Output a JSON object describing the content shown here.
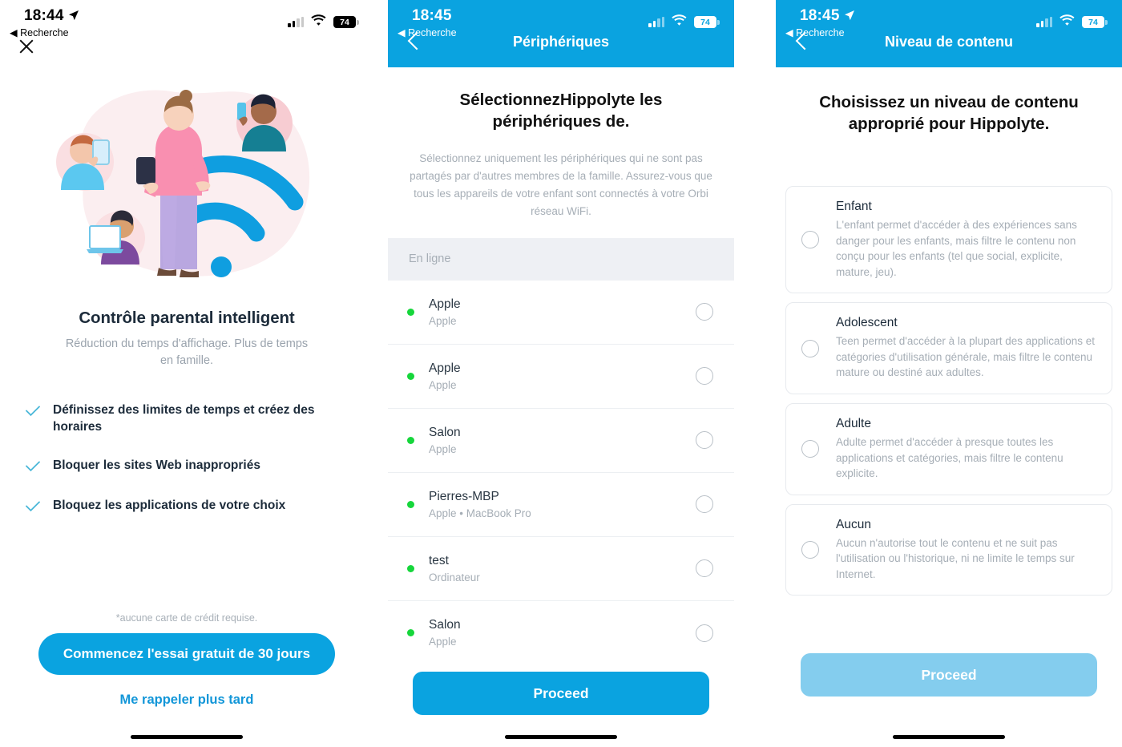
{
  "status_bar": {
    "time_left": "18:44",
    "time_mid": "18:45",
    "time_right": "18:45",
    "back_label": "◀ Recherche",
    "battery": "74",
    "location_arrow": "➤"
  },
  "colors": {
    "brand_blue": "#0aa3e0",
    "brand_blue_disabled": "#84cdee",
    "online_green": "#16d63b",
    "text_dark": "#1c2b3a",
    "text_muted": "#a6aeb6"
  },
  "onboarding": {
    "close_icon": "×",
    "title": "Contrôle parental intelligent",
    "subtitle": "Réduction du temps d'affichage. Plus de temps en famille.",
    "features": [
      "Définissez des limites de temps et créez des horaires",
      "Bloquer les sites Web inappropriés",
      "Bloquez les applications de votre choix"
    ],
    "note": "*aucune carte de crédit requise.",
    "cta_label": "Commencez l'essai gratuit de 30 jours",
    "secondary_label": "Me rappeler plus tard"
  },
  "devices": {
    "nav_title": "Périphériques",
    "title": "SélectionnezHippolyte les périphériques de.",
    "subtitle": "Sélectionnez uniquement les périphériques qui ne sont pas partagés par d'autres membres de la famille. Assurez-vous que tous les appareils de votre enfant sont connectés à votre Orbi réseau WiFi.",
    "section_header": "En ligne",
    "items": [
      {
        "name": "Apple",
        "sub": "Apple",
        "online": true,
        "selected": false
      },
      {
        "name": "Apple",
        "sub": "Apple",
        "online": true,
        "selected": false
      },
      {
        "name": "Salon",
        "sub": "Apple",
        "online": true,
        "selected": false
      },
      {
        "name": "Pierres-MBP",
        "sub": "Apple • MacBook Pro",
        "online": true,
        "selected": false
      },
      {
        "name": "test",
        "sub": "Ordinateur",
        "online": true,
        "selected": false
      },
      {
        "name": "Salon",
        "sub": "Apple",
        "online": true,
        "selected": false
      }
    ],
    "proceed_label": "Proceed"
  },
  "content_level": {
    "nav_title": "Niveau de contenu",
    "title": "Choisissez un niveau de contenu approprié pour Hippolyte.",
    "options": [
      {
        "label": "Enfant",
        "description": "L'enfant permet d'accéder à des expériences sans danger pour les enfants, mais filtre le contenu non conçu pour les enfants (tel que social, explicite, mature, jeu).",
        "selected": false
      },
      {
        "label": "Adolescent",
        "description": "Teen permet d'accéder à la plupart des applications et catégories d'utilisation générale, mais filtre le contenu mature ou destiné aux adultes.",
        "selected": false
      },
      {
        "label": "Adulte",
        "description": "Adulte permet d'accéder à presque toutes les applications et catégories, mais filtre le contenu explicite.",
        "selected": false
      },
      {
        "label": "Aucun",
        "description": "Aucun n'autorise tout le contenu et ne suit pas l'utilisation ou l'historique, ni ne limite le temps sur Internet.",
        "selected": false
      }
    ],
    "proceed_label": "Proceed"
  }
}
